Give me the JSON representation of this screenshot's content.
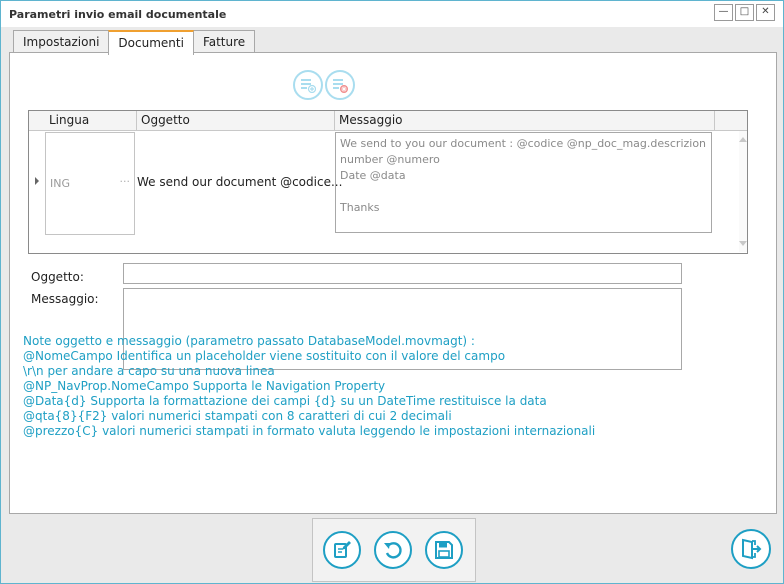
{
  "window": {
    "title": "Parametri invio email documentale",
    "controls": [
      "minimize-icon",
      "maximize-icon",
      "close-icon"
    ]
  },
  "tabs": [
    {
      "label": "Impostazioni",
      "active": false
    },
    {
      "label": "Documenti",
      "active": true
    },
    {
      "label": "Fatture",
      "active": false
    }
  ],
  "toolbar": {
    "icons": [
      "add-row-icon",
      "delete-row-icon"
    ]
  },
  "grid": {
    "columns": [
      "Lingua",
      "Oggetto",
      "Messaggio"
    ],
    "rows": [
      {
        "lingua": "ING",
        "lingua_button": "···",
        "oggetto": "We send our document @codice...",
        "messaggio": "We send to you our document : @codice @np_doc_mag.descrizion\nnumber @numero\nDate @data\n\nThanks"
      }
    ]
  },
  "form": {
    "oggetto_label": "Oggetto:",
    "oggetto_value": "",
    "messaggio_label": "Messaggio:",
    "messaggio_value": ""
  },
  "notes": [
    "Note oggetto e messaggio (parametro passato DatabaseModel.movmagt) :",
    "@NomeCampo  Identifica un placeholder viene sostituito con il valore del campo",
    "\\r\\n per andare a capo su una nuova linea",
    "@NP_NavProp.NomeCampo  Supporta le Navigation Property",
    "@Data{d} Supporta la formattazione dei campi {d} su un DateTime restituisce la data",
    "@qta{8}{F2} valori numerici stampati con 8 caratteri di cui 2 decimali",
    "@prezzo{C} valori numerici stampati in formato valuta leggendo le impostazioni internazionali"
  ],
  "colors": {
    "accent": "#1e9fc4",
    "tab_active_border": "#f0a030",
    "window_border": "#5fb4cf"
  },
  "bottom_buttons": [
    "edit-document-icon",
    "undo-icon",
    "save-icon"
  ],
  "exit_button": "exit-icon"
}
